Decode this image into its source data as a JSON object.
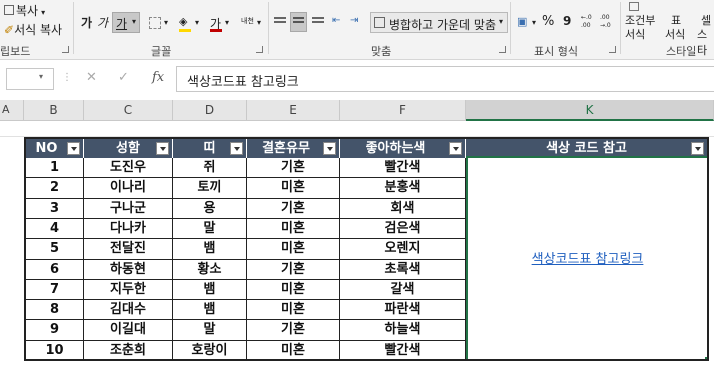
{
  "ribbon": {
    "clipboard": {
      "copy_label": "복사",
      "format_painter_label": "서식 복사",
      "group_label": "립보드"
    },
    "font": {
      "bold_glyph": "가",
      "italic_glyph": "가",
      "underline_glyph": "가",
      "font_color_glyph": "가",
      "font_color_accent": "#c00000",
      "phonetic_glyph": "내천",
      "group_label": "글꼴"
    },
    "alignment": {
      "merge_center_label": "병합하고 가운데 맞춤",
      "group_label": "맞춤"
    },
    "number": {
      "percent_glyph": "%",
      "comma_glyph": "9",
      "group_label": "표시 형식"
    },
    "styles": {
      "conditional_label": "조건부",
      "conditional_sub": "서식",
      "table_label": "표",
      "table_sub": "서식",
      "cell_styles_label": "셀",
      "cell_styles_sub": "스타",
      "group_label": "스타일"
    }
  },
  "formula_bar": {
    "cancel_glyph": "✕",
    "enter_glyph": "✓",
    "fx_label": "fx",
    "content": "색상코드표 참고링크"
  },
  "columns": [
    "A",
    "B",
    "C",
    "D",
    "E",
    "F",
    "K"
  ],
  "table": {
    "headers": [
      "NO",
      "성함",
      "띠",
      "결혼유무",
      "좋아하는색",
      "색상 코드 참고"
    ],
    "rows": [
      [
        "1",
        "도진우",
        "쥐",
        "기혼",
        "빨간색"
      ],
      [
        "2",
        "이나리",
        "토끼",
        "미혼",
        "분홍색"
      ],
      [
        "3",
        "구나군",
        "용",
        "기혼",
        "회색"
      ],
      [
        "4",
        "다나카",
        "말",
        "미혼",
        "검은색"
      ],
      [
        "5",
        "전달진",
        "뱀",
        "미혼",
        "오렌지"
      ],
      [
        "6",
        "하동현",
        "황소",
        "기혼",
        "초록색"
      ],
      [
        "7",
        "지두한",
        "뱀",
        "미혼",
        "갈색"
      ],
      [
        "8",
        "김대수",
        "뱀",
        "미혼",
        "파란색"
      ],
      [
        "9",
        "이길대",
        "말",
        "기혼",
        "하늘색"
      ],
      [
        "10",
        "조춘희",
        "호랑이",
        "미혼",
        "빨간색"
      ]
    ],
    "link_text": "색상코드표 참고링크"
  },
  "colors": {
    "header_bg": "#44546a",
    "selection": "#217346",
    "link": "#1f5fbf"
  }
}
